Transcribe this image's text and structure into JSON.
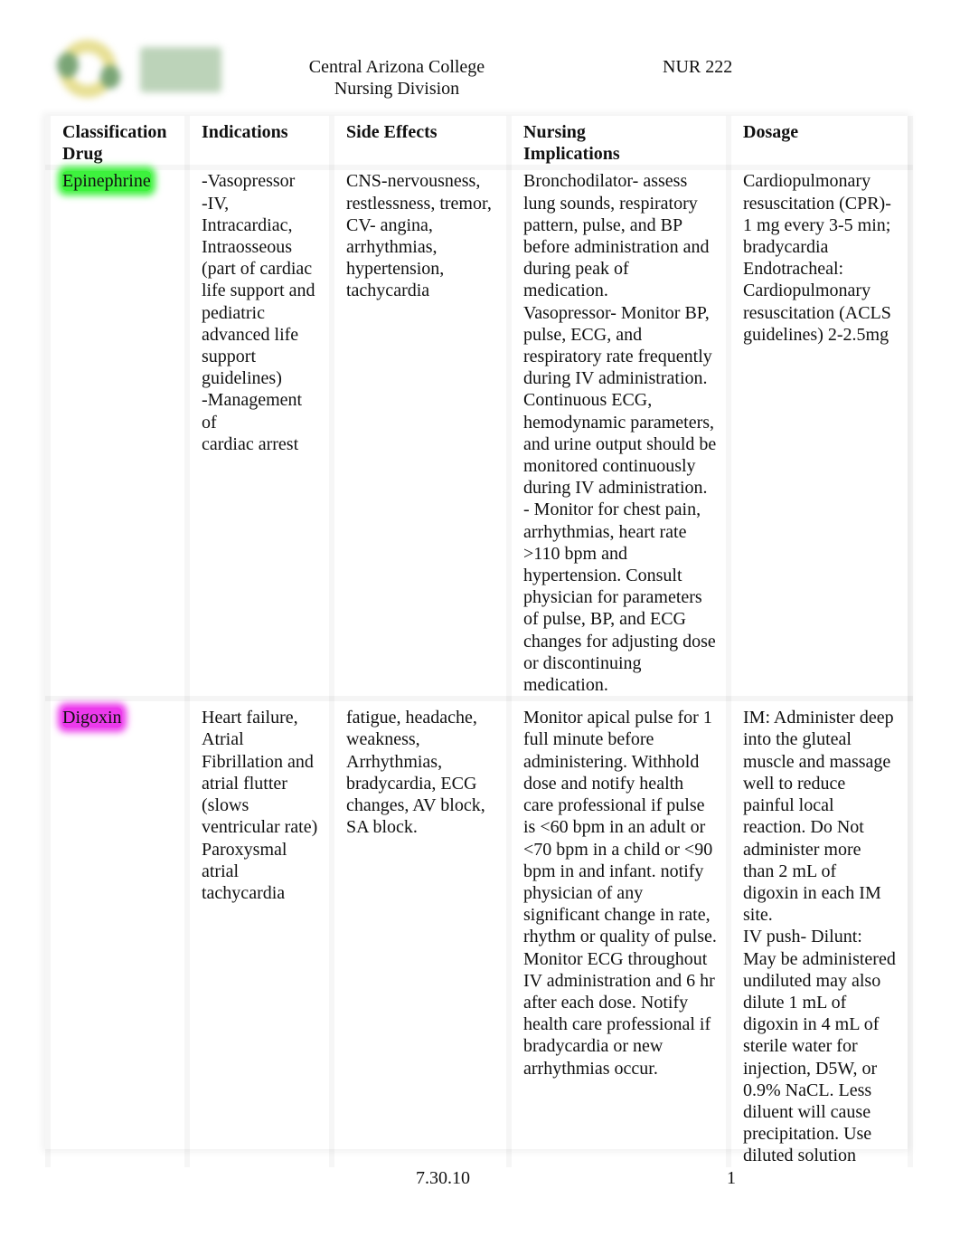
{
  "header": {
    "logo": "college-logo",
    "institution": "Central Arizona College",
    "division": "Nursing Division",
    "course": "NUR 222"
  },
  "table": {
    "columns": [
      "Classification\nDrug",
      "Indications",
      "Side Effects",
      "Nursing\nImplications",
      "Dosage"
    ],
    "rows": [
      {
        "drug": "Epinephrine",
        "highlight_color": "#3df23d",
        "indications": "-Vasopressor\n-IV,\nIntracardiac,\nIntraosseous\n(part of cardiac\nlife support and\npediatric\nadvanced life\nsupport\nguidelines)\n-Management of\ncardiac arrest",
        "side_effects": "CNS-nervousness,\nrestlessness, tremor,\nCV- angina,\narrhythmias,\nhypertension,\ntachycardia",
        "nursing_implications": "Bronchodilator- assess\nlung sounds, respiratory\npattern, pulse, and BP\nbefore administration and\nduring peak of\nmedication.\nVasopressor- Monitor BP,\npulse, ECG, and\nrespiratory rate frequently\nduring IV administration.\nContinuous ECG,\nhemodynamic parameters,\nand urine output should be\nmonitored continuously\nduring IV administration.\n- Monitor for chest pain,\narrhythmias, heart rate\n>110 bpm and\nhypertension. Consult\nphysician for parameters\nof pulse, BP, and ECG\nchanges for adjusting dose\nor discontinuing\nmedication.",
        "dosage": "Cardiopulmonary\nresuscitation (CPR)-\n1 mg every 3-5 min;\nbradycardia\nEndotracheal:\nCardiopulmonary\nresuscitation (ACLS\nguidelines) 2-2.5mg"
      },
      {
        "drug": "Digoxin",
        "highlight_color": "#ec3aec",
        "indications": "Heart failure,\nAtrial\nFibrillation and\natrial flutter\n(slows\nventricular rate)\nParoxysmal\natrial\ntachycardia",
        "side_effects": "fatigue, headache,\nweakness,\nArrhythmias,\nbradycardia, ECG\nchanges, AV block,\nSA block.",
        "nursing_implications": "Monitor apical pulse for 1\nfull minute before\nadministering. Withhold\ndose and notify health\ncare professional if pulse\nis <60 bpm in an adult or\n<70 bpm in a child or <90\nbpm in and infant. notify\nphysician of any\nsignificant change in rate,\nrhythm or quality of pulse.\nMonitor ECG throughout\nIV administration and 6 hr\nafter each dose. Notify\nhealth care professional if\nbradycardia or new\narrhythmias occur.",
        "dosage": "IM: Administer deep\ninto the gluteal\nmuscle and massage\nwell to reduce\npainful local\nreaction. Do Not\nadminister more\nthan 2 mL of\ndigoxin in each IM\nsite.\nIV push- Dilunt:\nMay be administered\nundiluted may also\ndilute 1 mL of\ndigoxin in 4 mL of\nsterile water for\ninjection, D5W, or\n0.9% NaCL. Less\ndiluent will cause\nprecipitation. Use\ndiluted solution"
      }
    ]
  },
  "footer": {
    "date": "7.30.10",
    "page_number": "1"
  }
}
